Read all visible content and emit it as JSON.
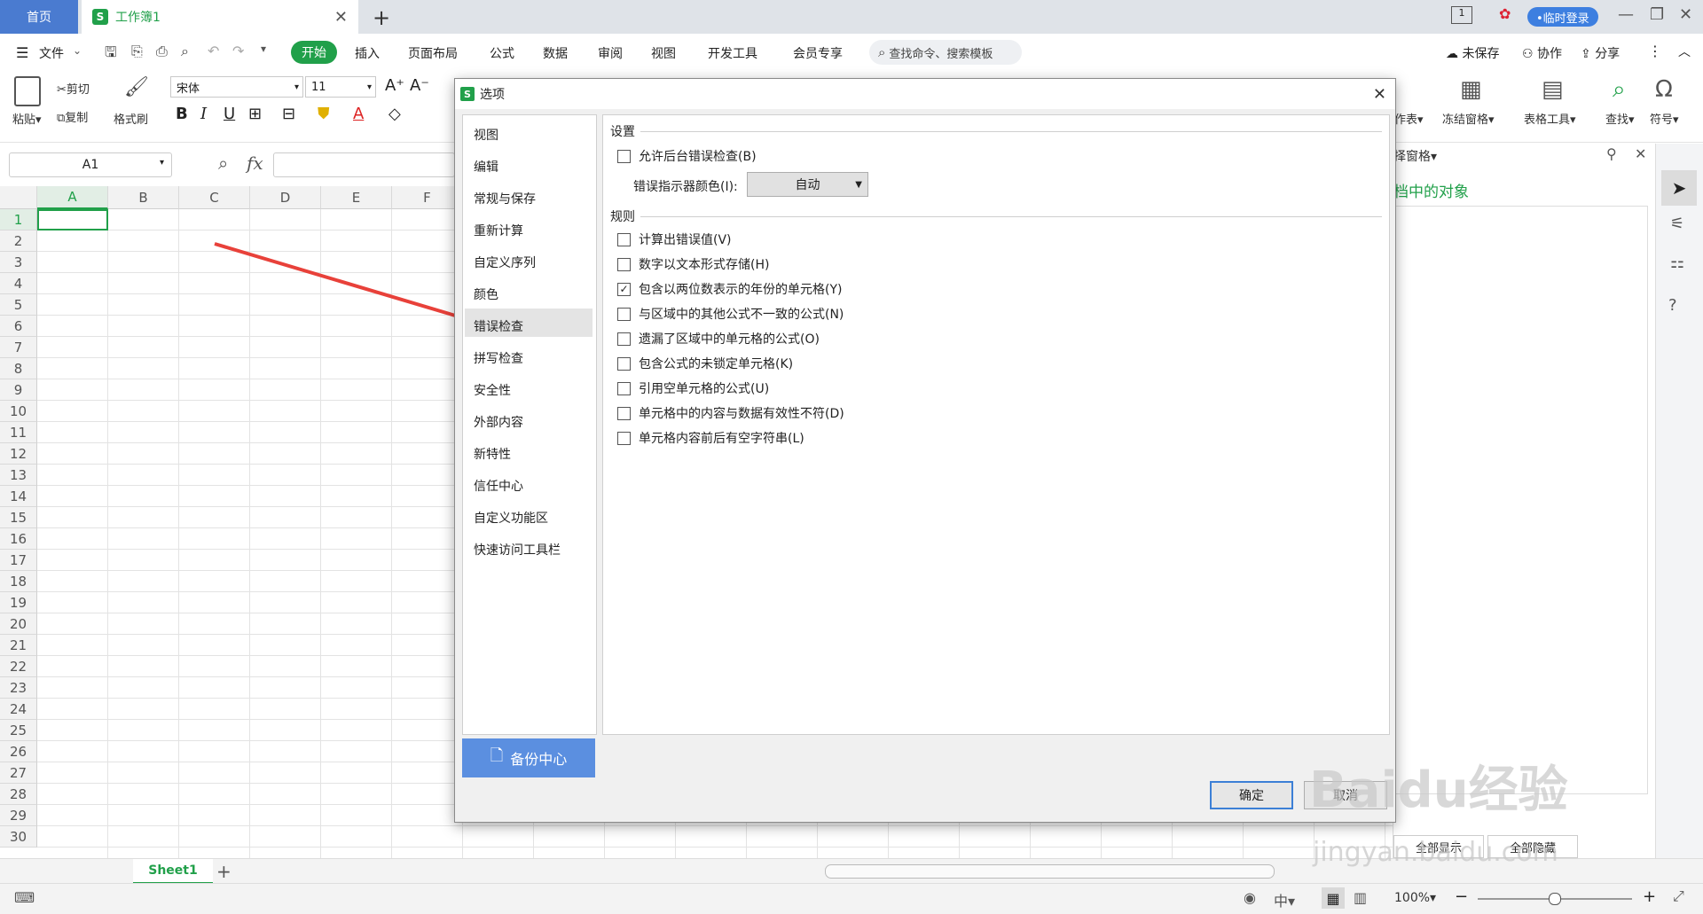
{
  "titlebar": {
    "home_tab": "首页",
    "doc_tab": "工作簿1",
    "doc_logo": "S",
    "login_btn": "•临时登录"
  },
  "menu": {
    "file": "文件",
    "items": [
      "开始",
      "插入",
      "页面布局",
      "公式",
      "数据",
      "审阅",
      "视图",
      "开发工具",
      "会员专享"
    ],
    "search_placeholder": "查找命令、搜索模板",
    "unsaved": "未保存",
    "collab": "协作",
    "share": "分享"
  },
  "ribbon": {
    "paste": "粘贴",
    "cut": "剪切",
    "copy": "复制",
    "format_painter": "格式刷",
    "font_name": "宋体",
    "font_size": "11",
    "freeze": "冻结窗格",
    "table_tools": "表格工具",
    "find": "查找",
    "symbol": "符号",
    "sheet_partial": "作表"
  },
  "formula": {
    "cell_ref": "A1",
    "fx": "fx"
  },
  "grid": {
    "columns": [
      "A",
      "B",
      "C",
      "D",
      "E",
      "F"
    ],
    "rows": [
      "1",
      "2",
      "3",
      "4",
      "5",
      "6",
      "7",
      "8",
      "9",
      "10",
      "11",
      "12",
      "13",
      "14",
      "15",
      "16",
      "17",
      "18",
      "19",
      "20",
      "21",
      "22",
      "23",
      "24",
      "25",
      "26",
      "27",
      "28",
      "29",
      "30"
    ]
  },
  "right_pane": {
    "title": "择窗格",
    "subtitle": "档中的对象",
    "show_all": "全部显示",
    "hide_all": "全部隐藏"
  },
  "sheetbar": {
    "sheet1": "Sheet1"
  },
  "statusbar": {
    "zoom": "100%"
  },
  "dialog": {
    "title": "选项",
    "logo": "S",
    "nav": [
      "视图",
      "编辑",
      "常规与保存",
      "重新计算",
      "自定义序列",
      "颜色",
      "错误检查",
      "拼写检查",
      "安全性",
      "外部内容",
      "新特性",
      "信任中心",
      "自定义功能区",
      "快速访问工具栏"
    ],
    "selected_nav": "错误检查",
    "backup_center": "备份中心",
    "settings_header": "设置",
    "enable_bg_check": "允许后台错误检查(B)",
    "indicator_color_label": "错误指示器颜色(I):",
    "indicator_color_value": "自动",
    "rules_header": "规则",
    "rules": [
      {
        "label": "计算出错误值(V)",
        "checked": false
      },
      {
        "label": "数字以文本形式存储(H)",
        "checked": false
      },
      {
        "label": "包含以两位数表示的年份的单元格(Y)",
        "checked": true
      },
      {
        "label": "与区域中的其他公式不一致的公式(N)",
        "checked": false
      },
      {
        "label": "遗漏了区域中的单元格的公式(O)",
        "checked": false
      },
      {
        "label": "包含公式的未锁定单元格(K)",
        "checked": false
      },
      {
        "label": "引用空单元格的公式(U)",
        "checked": false
      },
      {
        "label": "单元格中的内容与数据有效性不符(D)",
        "checked": false
      },
      {
        "label": "单元格内容前后有空字符串(L)",
        "checked": false
      }
    ],
    "ok": "确定",
    "cancel": "取消"
  },
  "watermark": {
    "brand": "Baidu经验",
    "url": "jingyan.baidu.com"
  },
  "colors": {
    "accent_green": "#21a04a",
    "accent_blue": "#3d7fe0",
    "arrow_red": "#e8413a"
  }
}
